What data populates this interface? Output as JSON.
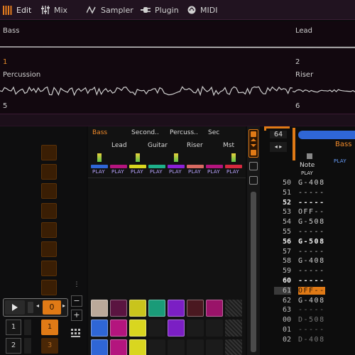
{
  "toolbar": {
    "tabs": [
      {
        "label": "Edit",
        "icon": "grid-icon"
      },
      {
        "label": "Mix",
        "icon": "sliders-icon"
      },
      {
        "label": "Sampler",
        "icon": "wave-icon"
      },
      {
        "label": "Plugin",
        "icon": "plug-icon"
      },
      {
        "label": "MIDI",
        "icon": "midi-icon"
      }
    ]
  },
  "waveforms": {
    "top_left_label": "Bass",
    "top_left_number": "1",
    "top_right_label": "Lead",
    "top_right_number": "2",
    "bottom_left_label": "Percussion",
    "bottom_left_number": "5",
    "bottom_right_label": "Riser",
    "bottom_right_number": "6"
  },
  "mixer": {
    "row1": [
      "Bass",
      "Second..",
      "Percuss..",
      "Sec"
    ],
    "row2": [
      "Lead",
      "Guitar",
      "Riser",
      "Mst"
    ],
    "play_label": "PLAY",
    "track_colors": [
      "#2f66d6",
      "#b4157e",
      "#d9d61f",
      "#1eb08a",
      "#8b21d6",
      "#d86a62",
      "#b4157e",
      "#d6293f"
    ]
  },
  "launcher": {
    "transport_value": "0",
    "rows": [
      {
        "number": "1",
        "value": "1"
      },
      {
        "number": "2",
        "value": "3"
      }
    ]
  },
  "pattern": {
    "length": "64",
    "track_name": "Bass",
    "play_label": "PLAY",
    "column_label": "Note",
    "rows": [
      {
        "num": "50",
        "note": "G-408"
      },
      {
        "num": "51",
        "note": "-----"
      },
      {
        "num": "52",
        "note": "-----"
      },
      {
        "num": "53",
        "note": "OFF--"
      },
      {
        "num": "54",
        "note": "G-508"
      },
      {
        "num": "55",
        "note": "-----"
      },
      {
        "num": "56",
        "note": "G-508"
      },
      {
        "num": "57",
        "note": "-----"
      },
      {
        "num": "58",
        "note": "G-408"
      },
      {
        "num": "59",
        "note": "-----"
      },
      {
        "num": "60",
        "note": "-----"
      },
      {
        "num": "61",
        "note": "OFF--"
      },
      {
        "num": "62",
        "note": "G-408"
      },
      {
        "num": "63",
        "note": "-----"
      },
      {
        "num": "00",
        "note": "D-508"
      },
      {
        "num": "01",
        "note": "-----"
      },
      {
        "num": "02",
        "note": "D-408"
      }
    ]
  }
}
